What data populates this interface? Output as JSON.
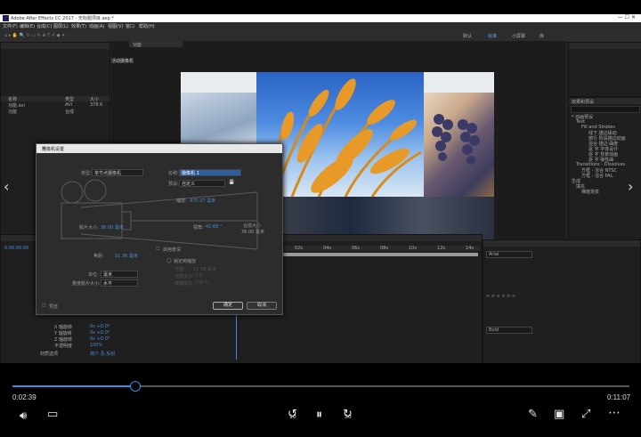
{
  "app": {
    "title": "Adobe After Effects CC 2017 - 无标题项目.aep *",
    "menu": [
      "文件(F)",
      "编辑(E)",
      "合成(C)",
      "图层(L)",
      "效果(T)",
      "动画(A)",
      "视图(V)",
      "窗口",
      "帮助(H)"
    ],
    "workspace_tabs": [
      "默认",
      "标准",
      "小屏幕",
      "库"
    ],
    "project_items": [
      {
        "name": "名称",
        "type": "类型",
        "size": "大小"
      },
      {
        "name": "功能.avi",
        "type": "AVI",
        "size": "378 K"
      },
      {
        "name": "功能",
        "type": "合成",
        "size": ""
      }
    ],
    "comp_tab": "功能",
    "comp_label": "活动摄像机",
    "timecode": "0:00:00:00",
    "effects_panel": {
      "title": "效果和预设",
      "items": [
        "* 动画预设",
        "Text",
        "Fill and Strokes",
        "线下 描边缘动",
        "按行 阶段描边动画",
        "混合 描边 曲度",
        "逐 字 字体设计",
        "逐 字 背景动画",
        "逐 字 弹性曲",
        "Transitions - Dissolves",
        "方框 - 溶合 NTSC",
        "方框 - 溶合 PAL",
        "生成",
        "填充",
        "梯度渐变"
      ]
    },
    "timeline": {
      "marks": [
        "02s",
        "04s",
        "06s",
        "08s",
        "10s",
        "12s",
        "14s"
      ],
      "layer_props": [
        {
          "label": "X 轴旋转",
          "value": "0x +0.0°"
        },
        {
          "label": "Y 轴旋转",
          "value": "0x +0.0°"
        },
        {
          "label": "Z 轴旋转",
          "value": "0x +0.0°"
        },
        {
          "label": "不透明度",
          "value": "100%"
        },
        {
          "label": "材质选项",
          "value": "简介 及 反射"
        }
      ]
    },
    "right_panel": {
      "title": "字符",
      "font": "Arial",
      "style": "Bold"
    }
  },
  "dialog": {
    "title": "摄像机设置",
    "type_label": "类型:",
    "type_value": "单节点摄像机",
    "name_label": "名称:",
    "name_value": "摄像机 1",
    "preset_label": "预设:",
    "preset_value": "自定义",
    "zoom_label": "缩放:",
    "zoom_value": "470.27 毫米",
    "film_size_label": "胶片大小:",
    "film_size_value": "36.00 毫米",
    "angle_label": "视角:",
    "angle_value": "42.68 °",
    "comp_size_label": "合成大小",
    "comp_size_value": "36.00 毫米",
    "dof_label": "启用景深",
    "focal_length_label": "焦距:",
    "focal_length_value": "51.36 毫米",
    "lock_zoom_label": "锁定到缩放",
    "units_label": "单位:",
    "units_value": "毫米",
    "measure_label": "量度胶片大小:",
    "measure_value": "水平",
    "aperture_label": "光圈:",
    "aperture_value": "17.78 毫米",
    "fstop_label": "光圈大小:",
    "fstop_value": "2.9",
    "blur_label": "模糊层次:",
    "blur_value": "100 %",
    "preview_label": "预览",
    "ok_label": "确定",
    "cancel_label": "取消"
  },
  "player": {
    "current_time": "0:02:39",
    "total_time": "0:11:07",
    "progress": 0.197,
    "skip_back_label": "10",
    "skip_fwd_label": "30"
  },
  "colors": {
    "accent": "#3c8ce6",
    "link": "#4a8cd8"
  }
}
